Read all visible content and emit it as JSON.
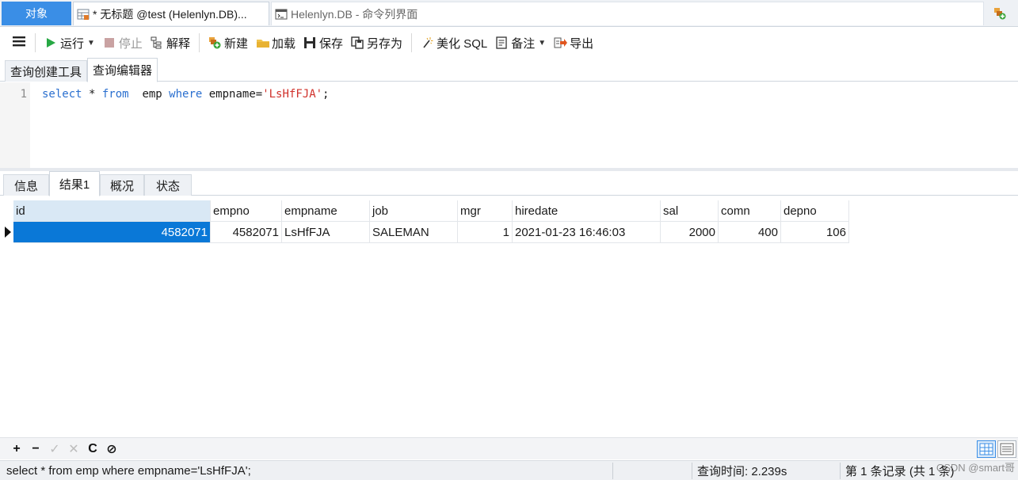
{
  "window_tabs": {
    "objects": "对象",
    "query": "* 无标题 @test (Helenlyn.DB)...",
    "command": "Helenlyn.DB - 命令列界面"
  },
  "toolbar": {
    "run": "运行",
    "stop": "停止",
    "explain": "解释",
    "new": "新建",
    "load": "加载",
    "save": "保存",
    "save_as": "另存为",
    "beautify": "美化 SQL",
    "comment": "备注",
    "export": "导出"
  },
  "editor_tabs": {
    "builder": "查询创建工具",
    "editor": "查询编辑器"
  },
  "editor": {
    "line_number": "1",
    "kw_select": "select",
    "star": " * ",
    "kw_from": "from",
    "table": "  emp ",
    "kw_where": "where",
    "condition": " empname=",
    "literal": "'LsHfFJA'",
    "end": ";"
  },
  "result_tabs": {
    "info": "信息",
    "result1": "结果1",
    "overview": "概况",
    "status": "状态"
  },
  "grid": {
    "columns": [
      "id",
      "empno",
      "empname",
      "job",
      "mgr",
      "hiredate",
      "sal",
      "comn",
      "depno"
    ],
    "row": [
      "4582071",
      "4582071",
      "LsHfFJA",
      "SALEMAN",
      "1",
      "2021-01-23 16:46:03",
      "2000",
      "400",
      "106"
    ]
  },
  "bottom_toolbar": {
    "add": "+",
    "delete": "−",
    "apply": "✓",
    "discard": "✕",
    "refresh": "C",
    "stop": "⊘"
  },
  "statusbar": {
    "sql": "select * from  emp where empname='LsHfFJA';",
    "query_time": "查询时间: 2.239s",
    "record": "第 1 条记录 (共 1 条)"
  },
  "watermark": "CSDN @smart哥",
  "colors": {
    "accent": "#3a8ee6",
    "selection": "#0a78d7",
    "keyword": "#2a6fcf",
    "string": "#d0302a"
  },
  "icons": [
    "table-tab-icon",
    "terminal-icon",
    "connection-add-icon",
    "hamburger-icon",
    "play-icon",
    "stop-icon",
    "explain-icon",
    "new-query-icon",
    "folder-icon",
    "save-icon",
    "save-as-icon",
    "magic-wand-icon",
    "note-icon",
    "export-icon"
  ]
}
